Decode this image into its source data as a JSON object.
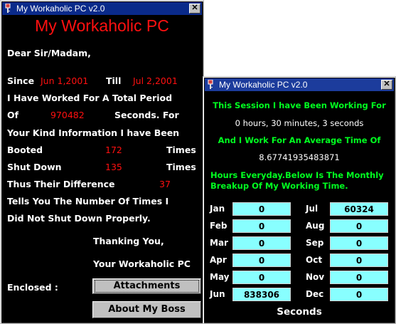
{
  "main_window": {
    "title": "My Workaholic PC v2.0",
    "heading": "My Workaholic PC",
    "greeting": "Dear Sir/Madam,",
    "since_label": "Since",
    "since_date": "Jun 1,2001",
    "till_label": "Till",
    "till_date": "Jul 2,2001",
    "line_worked": "I Have Worked For A Total Period",
    "of_label": "Of",
    "seconds_value": "970482",
    "seconds_label": "Seconds. For",
    "line_info": "Your Kind Information I have Been",
    "booted_label": "Booted",
    "booted_value": "172",
    "times_label": "Times",
    "shutdown_label": "Shut Down",
    "shutdown_value": "135",
    "difference_label": "Thus Their Difference",
    "difference_value": "37",
    "line_tells": "Tells You The Number Of Times I",
    "line_did_not": "Did Not Shut Down Properly.",
    "thanking": "Thanking You,",
    "signature": "Your Workaholic PC",
    "enclosed_label": "Enclosed :",
    "attachments_button": "Attachments",
    "about_boss_button": "About My Boss"
  },
  "session_window": {
    "title": "My Workaholic PC v2.0",
    "session_heading": "This Session I have Been Working For",
    "session_duration": "0 hours, 30 minutes, 3 seconds",
    "average_heading": "And I Work For An Average Time Of",
    "average_value": "8.67741935483871",
    "monthly_line1": "Hours Everyday.Below Is The Monthly",
    "monthly_line2": "Breakup Of My Working Time.",
    "months_left": [
      {
        "label": "Jan",
        "value": "0"
      },
      {
        "label": "Feb",
        "value": "0"
      },
      {
        "label": "Mar",
        "value": "0"
      },
      {
        "label": "Apr",
        "value": "0"
      },
      {
        "label": "May",
        "value": "0"
      },
      {
        "label": "Jun",
        "value": "838306"
      }
    ],
    "months_right": [
      {
        "label": "Jul",
        "value": "60324"
      },
      {
        "label": "Aug",
        "value": "0"
      },
      {
        "label": "Sep",
        "value": "0"
      },
      {
        "label": "Oct",
        "value": "0"
      },
      {
        "label": "Nov",
        "value": "0"
      },
      {
        "label": "Dec",
        "value": "0"
      }
    ],
    "seconds_footer": "Seconds"
  },
  "colors": {
    "title_bar": "#0a2a8a",
    "heading_red": "#ff1010",
    "accent_green": "#00ff20",
    "month_field": "#88ffff"
  },
  "icons": {
    "title_icon": "key-icon",
    "close_icon": "close-icon"
  }
}
